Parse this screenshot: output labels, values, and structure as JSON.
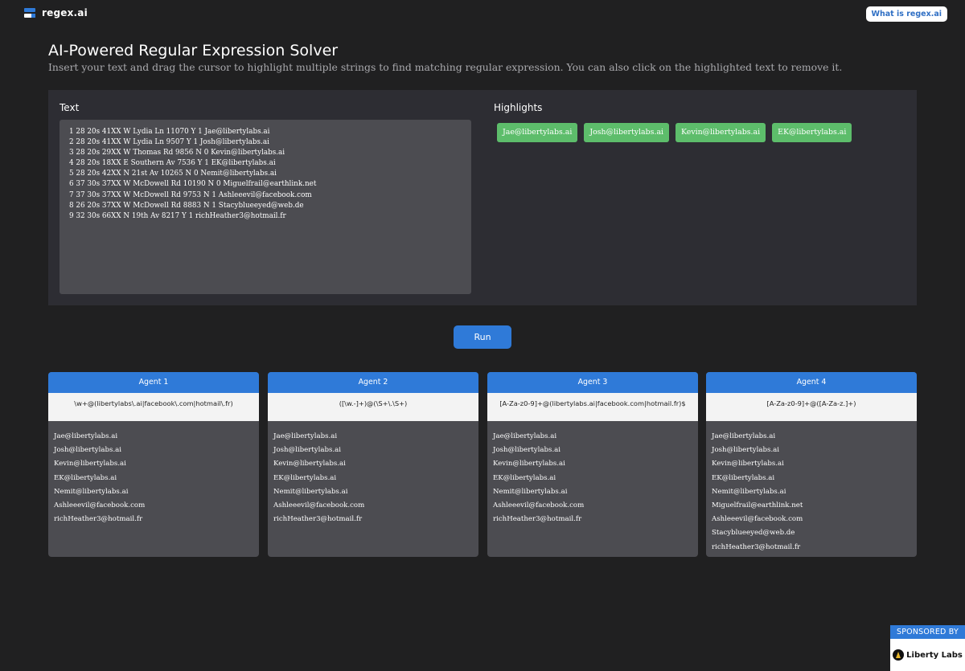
{
  "app": {
    "logo_text": "regex.ai",
    "what_button": "What is regex.ai"
  },
  "header": {
    "title": "AI-Powered Regular Expression Solver",
    "subtitle": "Insert your text and drag the cursor to highlight multiple strings to find matching regular expression. You can also click on the highlighted text to remove it."
  },
  "input_panel": {
    "text_label": "Text",
    "highlights_label": "Highlights",
    "text_lines": [
      "1 28 20s 41XX W Lydia Ln 11070 Y 1 Jae@libertylabs.ai",
      "2 28 20s 41XX W Lydia Ln 9507 Y 1 Josh@libertylabs.ai",
      "3 28 20s 29XX W Thomas Rd 9856 N 0 Kevin@libertylabs.ai",
      "4 28 20s 18XX E Southern Av 7536 Y 1 EK@libertylabs.ai",
      "5 28 20s 42XX N 21st Av 10265 N 0 Nemit@libertylabs.ai",
      "6 37 30s 37XX W McDowell Rd 10190 N 0 Miguelfrail@earthlink.net",
      "7 37 30s 37XX W McDowell Rd 9753 N 1 Ashleeevil@facebook.com",
      "8 26 20s 37XX W McDowell Rd 8883 N 1 Stacyblueeyed@web.de",
      "9 32 30s 66XX N 19th Av 8217 Y 1 richHeather3@hotmail.fr"
    ],
    "highlights": [
      "Jae@libertylabs.ai",
      "Josh@libertylabs.ai",
      "Kevin@libertylabs.ai",
      "EK@libertylabs.ai"
    ]
  },
  "run_button": "Run",
  "agents": [
    {
      "title": "Agent 1",
      "regex": "\\w+@(libertylabs\\.ai|facebook\\.com|hotmail\\.fr)",
      "matches": [
        "Jae@libertylabs.ai",
        "Josh@libertylabs.ai",
        "Kevin@libertylabs.ai",
        "EK@libertylabs.ai",
        "Nemit@libertylabs.ai",
        "Ashleeevil@facebook.com",
        "richHeather3@hotmail.fr"
      ]
    },
    {
      "title": "Agent 2",
      "regex": "([\\w.-]+)@(\\S+\\.\\S+)",
      "matches": [
        "Jae@libertylabs.ai",
        "Josh@libertylabs.ai",
        "Kevin@libertylabs.ai",
        "EK@libertylabs.ai",
        "Nemit@libertylabs.ai",
        "Ashleeevil@facebook.com",
        "richHeather3@hotmail.fr"
      ]
    },
    {
      "title": "Agent 3",
      "regex": "[A-Za-z0-9]+@(libertylabs.ai|facebook.com|hotmail.fr)$",
      "matches": [
        "Jae@libertylabs.ai",
        "Josh@libertylabs.ai",
        "Kevin@libertylabs.ai",
        "EK@libertylabs.ai",
        "Nemit@libertylabs.ai",
        "Ashleeevil@facebook.com",
        "richHeather3@hotmail.fr"
      ]
    },
    {
      "title": "Agent 4",
      "regex": "[A-Za-z0-9]+@([A-Za-z.]+)",
      "matches": [
        "Jae@libertylabs.ai",
        "Josh@libertylabs.ai",
        "Kevin@libertylabs.ai",
        "EK@libertylabs.ai",
        "Nemit@libertylabs.ai",
        "Miguelfrail@earthlink.net",
        "Ashleeevil@facebook.com",
        "Stacyblueeyed@web.de",
        "richHeather3@hotmail.fr"
      ]
    }
  ],
  "sponsor": {
    "label": "SPONSORED BY",
    "company": "Liberty Labs"
  },
  "colors": {
    "accent": "#2f7ad8",
    "highlight": "#5dbd6b",
    "background": "#202021"
  }
}
